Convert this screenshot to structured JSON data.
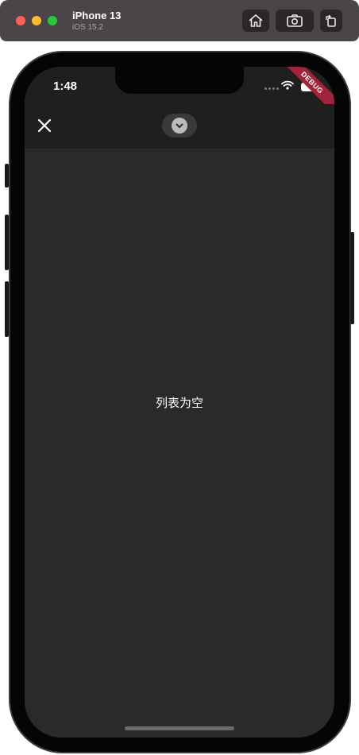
{
  "simulator": {
    "device_name": "iPhone 13",
    "os_version": "iOS 15.2",
    "buttons": [
      "home-icon",
      "screenshot-icon",
      "rotate-icon"
    ]
  },
  "status_bar": {
    "time": "1:48",
    "debug_label": "DEBUG"
  },
  "app_bar": {
    "close_icon": "close-icon",
    "handle_icon": "chevron-down-icon"
  },
  "content": {
    "empty_message": "列表为空"
  },
  "colors": {
    "background": "#2a2a2a",
    "appbar": "#1f1f1f",
    "debug_banner": "#a0243a",
    "text": "#ffffff"
  }
}
